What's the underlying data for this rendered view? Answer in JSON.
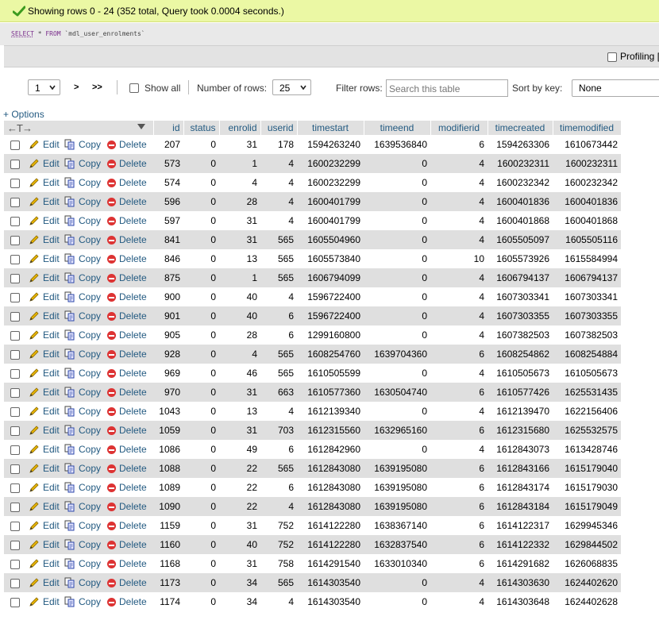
{
  "success": {
    "message": "Showing rows 0 - 24 (352 total, Query took 0.0004 seconds.)"
  },
  "sql": {
    "select_kw": "SELECT",
    "rest_1": " * ",
    "from_kw": "FROM",
    "table": " `mdl_user_enrolments`"
  },
  "profiling": {
    "label": "Profiling ["
  },
  "nav": {
    "page_value": "1",
    "next": ">",
    "last": ">>",
    "show_all": "Show all",
    "num_rows_label": "Number of rows:",
    "num_rows_value": "25",
    "filter_label": "Filter rows:",
    "filter_placeholder": "Search this table",
    "sort_label": "Sort by key:",
    "sort_value": "None"
  },
  "options_label": "+ Options",
  "actions": {
    "edit": "Edit",
    "copy": "Copy",
    "delete": "Delete"
  },
  "columns": [
    "id",
    "status",
    "enrolid",
    "userid",
    "timestart",
    "timeend",
    "modifierid",
    "timecreated",
    "timemodified"
  ],
  "rows": [
    [
      "207",
      "0",
      "31",
      "178",
      "1594263240",
      "1639536840",
      "6",
      "1594263306",
      "1610673442"
    ],
    [
      "573",
      "0",
      "1",
      "4",
      "1600232299",
      "0",
      "4",
      "1600232311",
      "1600232311"
    ],
    [
      "574",
      "0",
      "4",
      "4",
      "1600232299",
      "0",
      "4",
      "1600232342",
      "1600232342"
    ],
    [
      "596",
      "0",
      "28",
      "4",
      "1600401799",
      "0",
      "4",
      "1600401836",
      "1600401836"
    ],
    [
      "597",
      "0",
      "31",
      "4",
      "1600401799",
      "0",
      "4",
      "1600401868",
      "1600401868"
    ],
    [
      "841",
      "0",
      "31",
      "565",
      "1605504960",
      "0",
      "4",
      "1605505097",
      "1605505116"
    ],
    [
      "846",
      "0",
      "13",
      "565",
      "1605573840",
      "0",
      "10",
      "1605573926",
      "1615584994"
    ],
    [
      "875",
      "0",
      "1",
      "565",
      "1606794099",
      "0",
      "4",
      "1606794137",
      "1606794137"
    ],
    [
      "900",
      "0",
      "40",
      "4",
      "1596722400",
      "0",
      "4",
      "1607303341",
      "1607303341"
    ],
    [
      "901",
      "0",
      "40",
      "6",
      "1596722400",
      "0",
      "4",
      "1607303355",
      "1607303355"
    ],
    [
      "905",
      "0",
      "28",
      "6",
      "1299160800",
      "0",
      "4",
      "1607382503",
      "1607382503"
    ],
    [
      "928",
      "0",
      "4",
      "565",
      "1608254760",
      "1639704360",
      "6",
      "1608254862",
      "1608254884"
    ],
    [
      "969",
      "0",
      "46",
      "565",
      "1610505599",
      "0",
      "4",
      "1610505673",
      "1610505673"
    ],
    [
      "970",
      "0",
      "31",
      "663",
      "1610577360",
      "1630504740",
      "6",
      "1610577426",
      "1625531435"
    ],
    [
      "1043",
      "0",
      "13",
      "4",
      "1612139340",
      "0",
      "4",
      "1612139470",
      "1622156406"
    ],
    [
      "1059",
      "0",
      "31",
      "703",
      "1612315560",
      "1632965160",
      "6",
      "1612315680",
      "1625532575"
    ],
    [
      "1086",
      "0",
      "49",
      "6",
      "1612842960",
      "0",
      "4",
      "1612843073",
      "1613428746"
    ],
    [
      "1088",
      "0",
      "22",
      "565",
      "1612843080",
      "1639195080",
      "6",
      "1612843166",
      "1615179040"
    ],
    [
      "1089",
      "0",
      "22",
      "6",
      "1612843080",
      "1639195080",
      "6",
      "1612843174",
      "1615179030"
    ],
    [
      "1090",
      "0",
      "22",
      "4",
      "1612843080",
      "1639195080",
      "6",
      "1612843184",
      "1615179049"
    ],
    [
      "1159",
      "0",
      "31",
      "752",
      "1614122280",
      "1638367140",
      "6",
      "1614122317",
      "1629945346"
    ],
    [
      "1160",
      "0",
      "40",
      "752",
      "1614122280",
      "1632837540",
      "6",
      "1614122332",
      "1629844502"
    ],
    [
      "1168",
      "0",
      "31",
      "758",
      "1614291540",
      "1633010340",
      "6",
      "1614291682",
      "1626068835"
    ],
    [
      "1173",
      "0",
      "34",
      "565",
      "1614303540",
      "0",
      "4",
      "1614303630",
      "1624402620"
    ],
    [
      "1174",
      "0",
      "34",
      "4",
      "1614303540",
      "0",
      "4",
      "1614303648",
      "1624402628"
    ]
  ]
}
